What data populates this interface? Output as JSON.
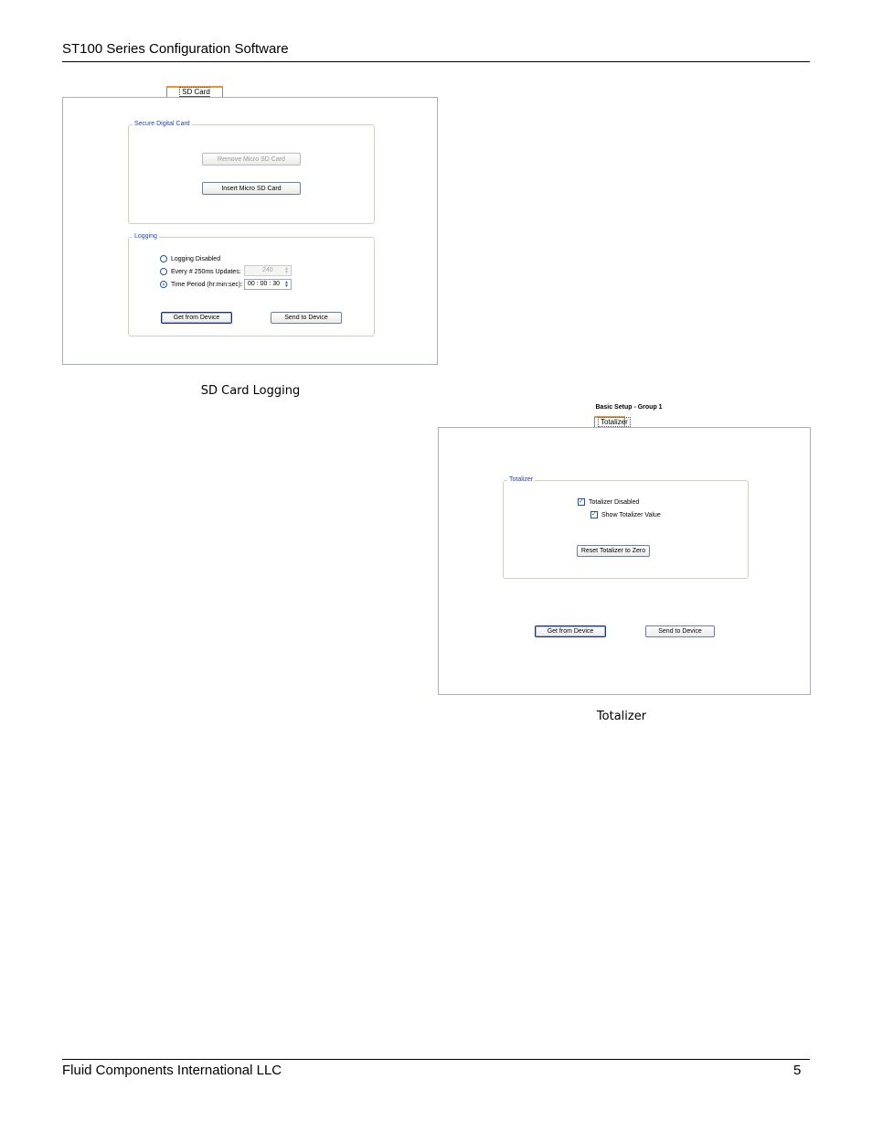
{
  "header": {
    "title": "ST100 Series Configuration Software"
  },
  "footer": {
    "company": "Fluid Components International LLC",
    "page_number": "5"
  },
  "sd_panel": {
    "tab_label": "SD Card Logging",
    "secure_group_label": "Secure Digital Card",
    "remove_button": "Remove Micro SD Card",
    "insert_button": "Insert Micro SD Card",
    "logging_group_label": "Logging",
    "option_disabled": "Logging Disabled",
    "option_every": "Every # 250ms Updates:",
    "every_value": "240",
    "option_time": "Time Period (hr:min:sec):",
    "time_value": "00 : 00 : 30",
    "selected_option": "time",
    "get_button": "Get from Device",
    "send_button": "Send to Device",
    "caption": "SD Card Logging"
  },
  "totalizer_panel": {
    "group_title": "Basic Setup - Group 1",
    "tab_label": "Totalizer",
    "group_label": "Totalizer",
    "disabled_checkbox": "Totalizer Disabled",
    "disabled_checked": true,
    "show_checkbox": "Show Totalizer Value",
    "show_checked": true,
    "reset_button": "Reset Totalizer to Zero",
    "get_button": "Get from Device",
    "send_button": "Send to Device",
    "caption": "Totalizer"
  }
}
